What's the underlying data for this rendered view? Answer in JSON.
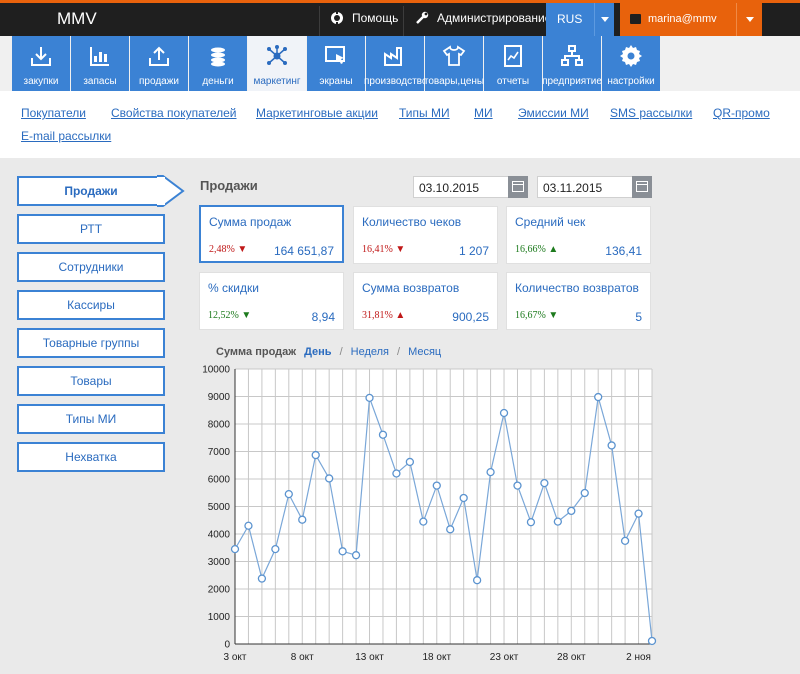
{
  "app": {
    "title": "MMV"
  },
  "topbar": {
    "help_label": "Помощь",
    "admin_label": "Администрирование",
    "language": "RUS",
    "user": "marina@mmv"
  },
  "nav": [
    {
      "label": "закупки",
      "icon": "download-box-icon"
    },
    {
      "label": "запасы",
      "icon": "warehouse-chart-icon"
    },
    {
      "label": "продажи",
      "icon": "upload-box-icon"
    },
    {
      "label": "деньги",
      "icon": "coins-icon"
    },
    {
      "label": "маркетинг",
      "icon": "network-icon",
      "active": true
    },
    {
      "label": "экраны",
      "icon": "screen-cursor-icon"
    },
    {
      "label": "производство",
      "icon": "factory-icon"
    },
    {
      "label": "товары,цены",
      "icon": "shirt-icon"
    },
    {
      "label": "отчеты",
      "icon": "report-icon"
    },
    {
      "label": "предприятие",
      "icon": "org-chart-icon"
    },
    {
      "label": "настройки",
      "icon": "gear-icon"
    }
  ],
  "subnav": [
    "Покупатели",
    "Свойства покупателей",
    "Маркетинговые акции",
    "Типы МИ",
    "МИ",
    "Эмиссии МИ",
    "SMS рассылки",
    "QR-промо",
    "E-mail рассылки"
  ],
  "leftnav": [
    {
      "label": "Продажи",
      "active": true
    },
    {
      "label": "РТТ"
    },
    {
      "label": "Сотрудники"
    },
    {
      "label": "Кассиры"
    },
    {
      "label": "Товарные группы"
    },
    {
      "label": "Товары"
    },
    {
      "label": "Типы МИ"
    },
    {
      "label": "Нехватка"
    }
  ],
  "section": {
    "title": "Продажи",
    "date_from": "03.10.2015",
    "date_to": "03.11.2015"
  },
  "kpis": [
    {
      "label": "Сумма продаж",
      "pct": "2,48%",
      "dir": "down",
      "arrow": "▼",
      "pct_color": "#c01818",
      "value": "164 651,87",
      "selected": true
    },
    {
      "label": "Количество чеков",
      "pct": "16,41%",
      "dir": "down",
      "arrow": "▼",
      "pct_color": "#c01818",
      "value": "1 207"
    },
    {
      "label": "Средний чек",
      "pct": "16,66%",
      "dir": "up",
      "arrow": "▲",
      "pct_color": "#1d7a1d",
      "value": "136,41"
    },
    {
      "label": "% скидки",
      "pct": "12,52%",
      "dir": "down",
      "arrow": "▼",
      "pct_color": "#1d7a1d",
      "value": "8,94"
    },
    {
      "label": "Сумма возвратов",
      "pct": "31,81%",
      "dir": "up",
      "arrow": "▲",
      "pct_color": "#c01818",
      "value": "900,25"
    },
    {
      "label": "Количество возвратов",
      "pct": "16,67%",
      "dir": "down",
      "arrow": "▼",
      "pct_color": "#1d7a1d",
      "value": "5"
    }
  ],
  "chart_tabs": {
    "label": "Сумма продаж",
    "day": "День",
    "week": "Неделя",
    "month": "Месяц",
    "sep": "/"
  },
  "chart_data": {
    "type": "line",
    "x": [
      "3 окт",
      "4 окт",
      "5 окт",
      "6 окт",
      "7 окт",
      "8 окт",
      "9 окт",
      "10 окт",
      "11 окт",
      "12 окт",
      "13 окт",
      "14 окт",
      "15 окт",
      "16 окт",
      "17 окт",
      "18 окт",
      "19 окт",
      "20 окт",
      "21 окт",
      "22 окт",
      "23 окт",
      "24 окт",
      "25 окт",
      "26 окт",
      "27 окт",
      "28 окт",
      "29 окт",
      "30 окт",
      "31 окт",
      "1 ноя",
      "2 ноя",
      "3 ноя"
    ],
    "xticks": [
      "3 окт",
      "8 окт",
      "13 окт",
      "18 окт",
      "23 окт",
      "28 окт",
      "2 ноя"
    ],
    "values": [
      3450,
      4300,
      2380,
      3450,
      5450,
      4520,
      6870,
      6020,
      3370,
      3230,
      8950,
      7610,
      6200,
      6620,
      4450,
      5760,
      4170,
      5310,
      2320,
      6250,
      8400,
      5760,
      4430,
      5850,
      4450,
      4840,
      5490,
      8980,
      7220,
      3750,
      4740,
      110
    ],
    "ylim": [
      0,
      10000
    ],
    "yticks": [
      0,
      1000,
      2000,
      3000,
      4000,
      5000,
      6000,
      7000,
      8000,
      9000,
      10000
    ],
    "grid": true,
    "color": "#7aa7d8"
  },
  "colors": {
    "accent": "#3b82d4",
    "brand": "#e8620c",
    "topbar": "#1f1f1f"
  }
}
